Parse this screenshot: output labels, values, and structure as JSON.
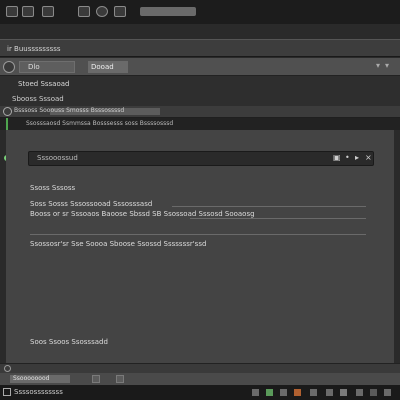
{
  "toolbar": {
    "icons": [
      "back-icon",
      "page-icon",
      "tab-icon",
      "bookmark-icon",
      "refresh-icon",
      "search-icon"
    ],
    "search_value": ""
  },
  "tabstrip": {
    "active_tab_label": "ir Buusssssssss"
  },
  "address": {
    "field_label": "Dlo",
    "secondary_label": "Dooad",
    "menu_icon": "chevron-down-icon"
  },
  "section": {
    "title": "Stoed Sssaoad",
    "subtitle": "Sbooss Sssoad"
  },
  "tree": {
    "label": "Bsssoss Sooouss Smosss Bsssossssd",
    "strip_text": "Ssosssaosd Ssmmssa Bosssesss soss Bssssosssd"
  },
  "input": {
    "value": "Sssooossud",
    "controls": [
      "checkbox-icon",
      "dot-icon",
      "arrow-icon",
      "x-icon"
    ]
  },
  "content": {
    "heading": "Ssoss Sssoss",
    "line1": "Soss Sosss Sssossooad Sssosssasd",
    "line2": "Booss or sr Sssoaos Baoose Sbssd SB Ssossoad Sssosd Sooaosg",
    "line3": "Ssossosr'sr Sse Soooa Sboose Ssossd Sssssssr'ssd",
    "bottom_note": "Soos Ssoos Ssosssadd"
  },
  "footer": {
    "field_label": "Ssoooooood",
    "task_label": "Ssssossssssss"
  },
  "colors": {
    "accent_green": "#4fa54f",
    "pane": "#444444",
    "chrome": "#1c1c1c"
  }
}
